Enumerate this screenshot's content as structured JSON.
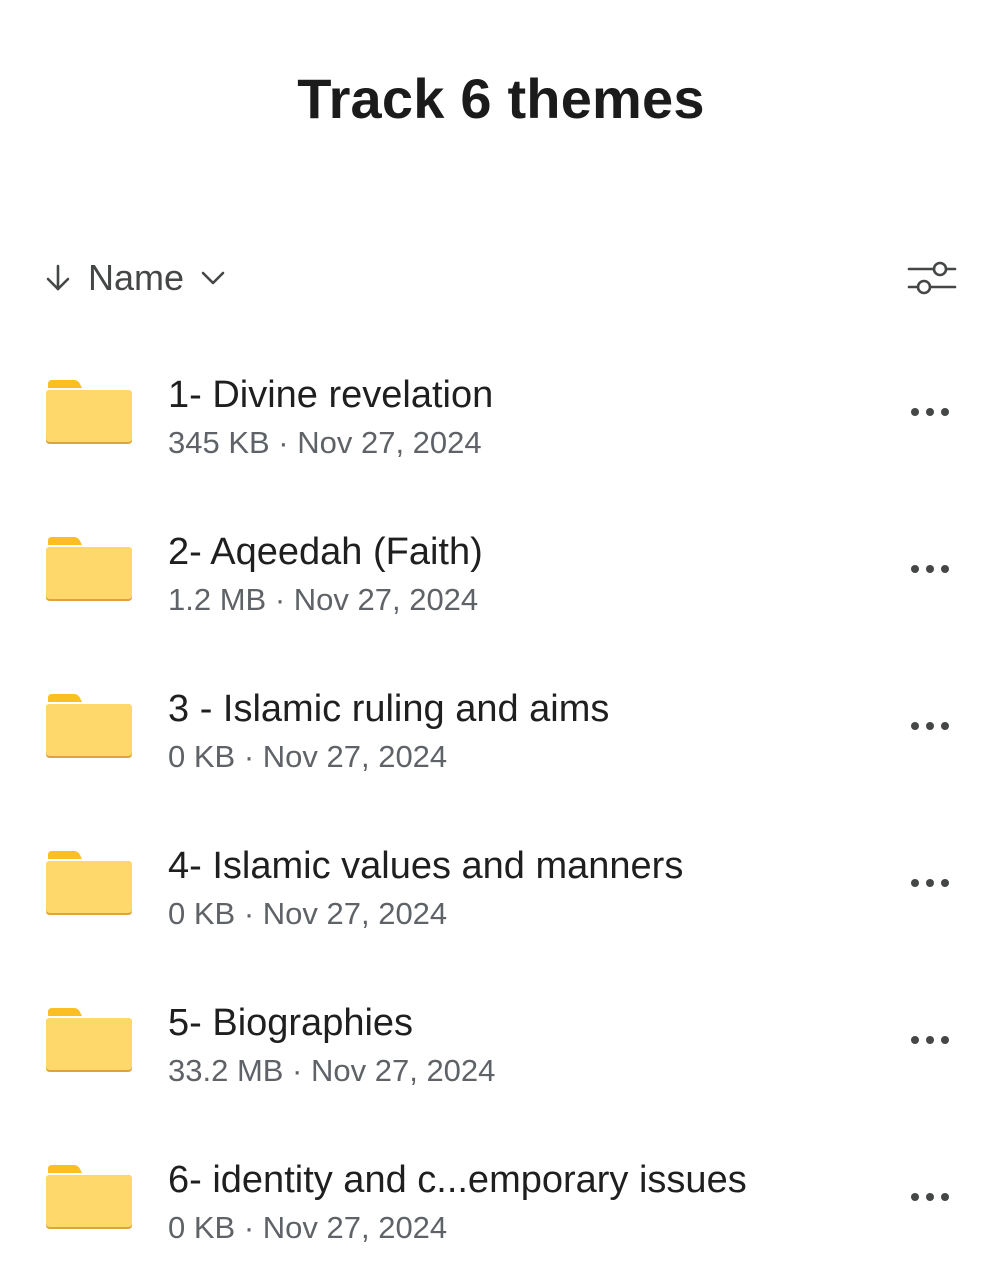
{
  "header": {
    "title": "Track 6 themes"
  },
  "sort": {
    "label": "Name",
    "direction_icon": "arrow-down-icon",
    "dropdown_icon": "chevron-down-icon",
    "filter_icon": "filter-sliders-icon"
  },
  "colors": {
    "folder_body": "#FFD86B",
    "folder_tab": "#FBBF24",
    "folder_shadow": "#E0A23A",
    "text_primary": "#1f1f1f",
    "text_secondary": "#5f6368"
  },
  "files": [
    {
      "name": "1- Divine revelation",
      "meta": "345 KB · Nov 27, 2024",
      "icon": "folder-icon"
    },
    {
      "name": "2- Aqeedah (Faith)",
      "meta": "1.2 MB · Nov 27, 2024",
      "icon": "folder-icon"
    },
    {
      "name": "3 - Islamic ruling and aims",
      "meta": "0 KB · Nov 27, 2024",
      "icon": "folder-icon"
    },
    {
      "name": "4- Islamic values and manners",
      "meta": "0 KB · Nov 27, 2024",
      "icon": "folder-icon"
    },
    {
      "name": "5- Biographies",
      "meta": "33.2 MB · Nov 27, 2024",
      "icon": "folder-icon"
    },
    {
      "name": "6- identity and c...emporary issues",
      "meta": "0 KB · Nov 27, 2024",
      "icon": "folder-icon"
    }
  ]
}
